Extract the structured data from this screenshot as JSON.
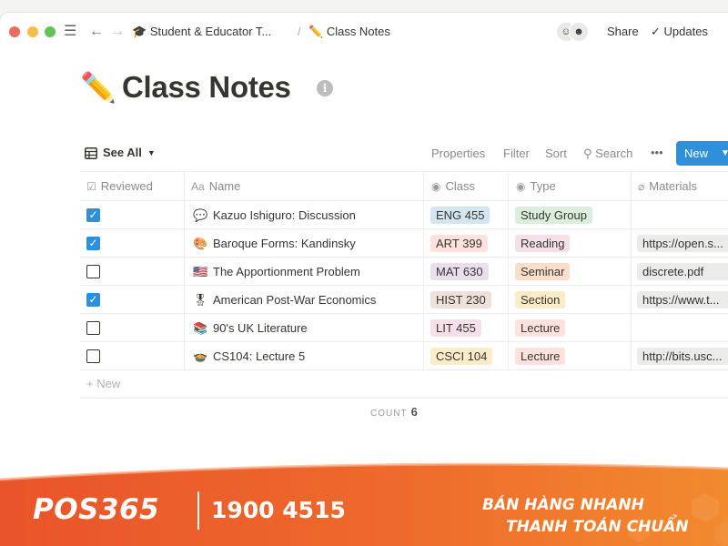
{
  "window": {
    "breadcrumb": {
      "parent": "Student & Educator T...",
      "parent_icon": "graduation-cap-icon",
      "separator": "/",
      "current": "Class Notes",
      "current_icon": "pencil-icon"
    },
    "actions": {
      "share": "Share",
      "updates": "Updates"
    }
  },
  "page": {
    "title": "Class Notes",
    "title_icon": "pencil-icon"
  },
  "view": {
    "name": "See All",
    "properties": "Properties",
    "filter": "Filter",
    "sort": "Sort",
    "search": "Search",
    "more": "•••",
    "new_button": "New"
  },
  "table": {
    "columns": {
      "reviewed": "Reviewed",
      "name": "Name",
      "class": "Class",
      "type": "Type",
      "materials": "Materials"
    },
    "rows": [
      {
        "reviewed": true,
        "icon": "💬",
        "name": "Kazuo Ishiguro: Discussion",
        "class": "ENG 455",
        "type": "Study Group",
        "materials": ""
      },
      {
        "reviewed": true,
        "icon": "🎨",
        "name": "Baroque Forms: Kandinsky",
        "class": "ART 399",
        "type": "Reading",
        "materials": "https://open.s..."
      },
      {
        "reviewed": false,
        "icon": "🇺🇸",
        "name": "The Apportionment Problem",
        "class": "MAT 630",
        "type": "Seminar",
        "materials": "discrete.pdf"
      },
      {
        "reviewed": true,
        "icon": "🎖",
        "name": "American Post-War Economics",
        "class": "HIST 230",
        "type": "Section",
        "materials": "https://www.t..."
      },
      {
        "reviewed": false,
        "icon": "📚",
        "name": "90's UK Literature",
        "class": "LIT 455",
        "type": "Lecture",
        "materials": ""
      },
      {
        "reviewed": false,
        "icon": "🍲",
        "name": "CS104: Lecture 5",
        "class": "CSCI 104",
        "type": "Lecture",
        "materials": "http://bits.usc..."
      }
    ],
    "add_new": "New",
    "count_label": "COUNT",
    "count_value": "6"
  },
  "tag_colors": {
    "ENG 455": "#d3e5ef",
    "ART 399": "#ffe2dd",
    "MAT 630": "#e8deee",
    "HIST 230": "#eee0da",
    "LIT 455": "#f5e0e9",
    "CSCI 104": "#fdecc8",
    "Study Group": "#dbeddb",
    "Reading": "#f5e0e9",
    "Seminar": "#fadec9",
    "Section": "#fdecc8",
    "Lecture": "#ffe2dd"
  },
  "banner": {
    "brand": "POS365",
    "phone": "1900 4515",
    "slogan_line1": "BÁN HÀNG NHANH",
    "slogan_line2": "THANH TOÁN CHUẨN",
    "accent": "#e8552a"
  }
}
